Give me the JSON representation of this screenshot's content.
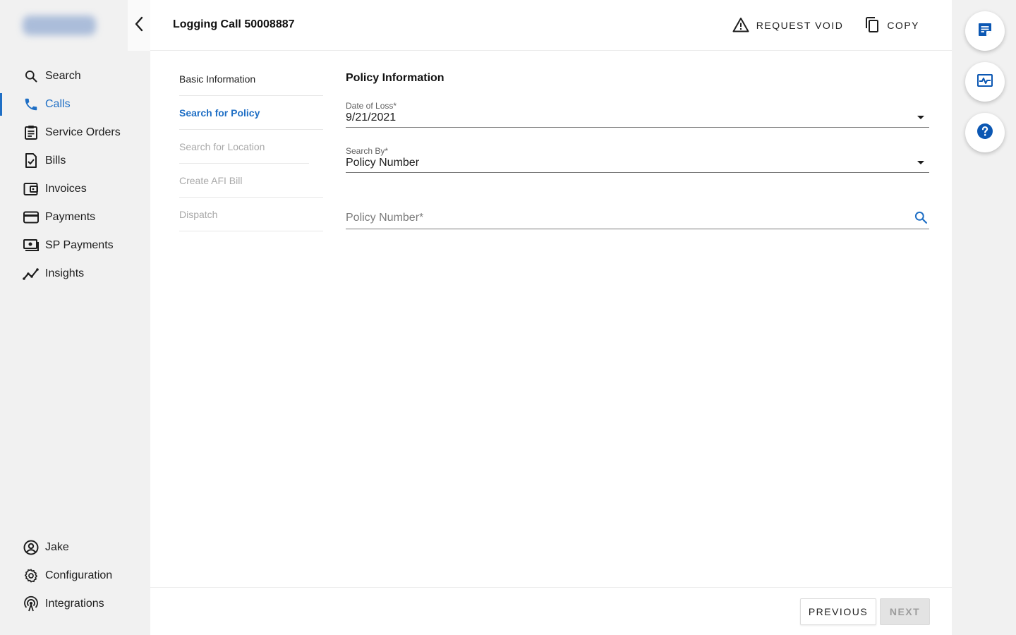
{
  "sidebar": {
    "items": [
      {
        "label": "Search",
        "icon": "search-icon"
      },
      {
        "label": "Calls",
        "icon": "phone-icon",
        "active": true
      },
      {
        "label": "Service Orders",
        "icon": "clipboard-icon"
      },
      {
        "label": "Bills",
        "icon": "bill-icon"
      },
      {
        "label": "Invoices",
        "icon": "wallet-icon"
      },
      {
        "label": "Payments",
        "icon": "credit-card-icon"
      },
      {
        "label": "SP Payments",
        "icon": "cash-icon"
      },
      {
        "label": "Insights",
        "icon": "insights-icon"
      }
    ],
    "bottom_items": [
      {
        "label": "Jake",
        "icon": "account-icon"
      },
      {
        "label": "Configuration",
        "icon": "gear-icon"
      },
      {
        "label": "Integrations",
        "icon": "antenna-icon"
      }
    ]
  },
  "header": {
    "title": "Logging Call 50008887",
    "request_void_label": "REQUEST VOID",
    "copy_label": "COPY"
  },
  "steps": [
    {
      "label": "Basic Information",
      "state": "done"
    },
    {
      "label": "Search for Policy",
      "state": "active"
    },
    {
      "label": "Search for Location",
      "state": "disabled"
    },
    {
      "label": "Create AFI Bill",
      "state": "disabled"
    },
    {
      "label": "Dispatch",
      "state": "disabled"
    }
  ],
  "form": {
    "section_title": "Policy Information",
    "date_of_loss": {
      "label": "Date of Loss*",
      "value": "9/21/2021"
    },
    "search_by": {
      "label": "Search By*",
      "value": "Policy Number"
    },
    "policy_number": {
      "placeholder": "Policy Number*",
      "value": ""
    }
  },
  "footer": {
    "previous_label": "PREVIOUS",
    "next_label": "NEXT"
  },
  "colors": {
    "accent": "#1f6fc5",
    "fab_icon": "#0b57b3"
  }
}
